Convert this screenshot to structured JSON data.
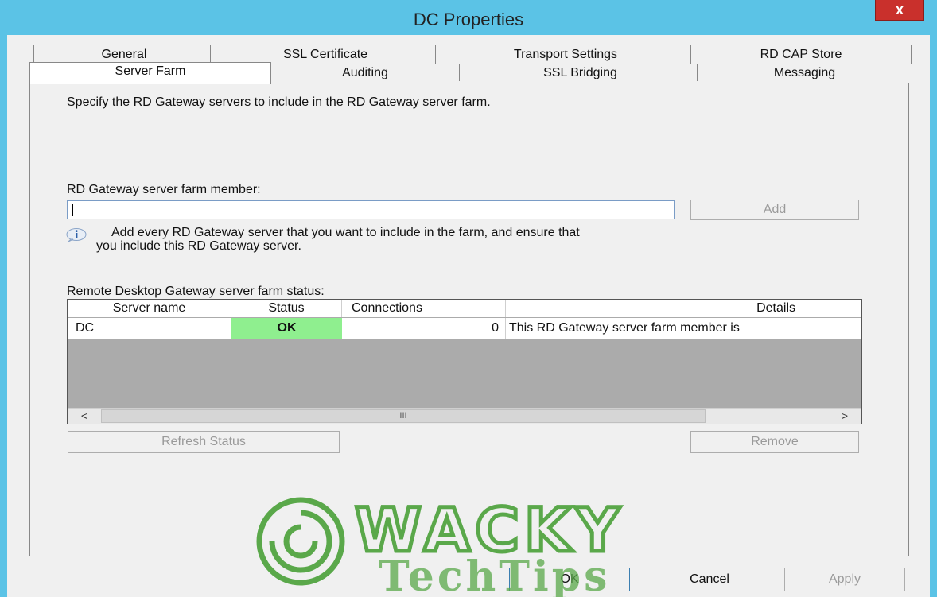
{
  "window": {
    "title": "DC Properties",
    "close_label": "x"
  },
  "tabs": {
    "row1": [
      "General",
      "SSL Certificate",
      "Transport Settings",
      "RD CAP Store"
    ],
    "row2": [
      "Server Farm",
      "Auditing",
      "SSL Bridging",
      "Messaging"
    ],
    "selected": "Server Farm"
  },
  "server_farm": {
    "description": "Specify the RD Gateway servers to include in the RD Gateway server farm.",
    "member_label": "RD Gateway server farm member:",
    "member_value": "",
    "add_label": "Add",
    "info_line1": "Add every RD Gateway server that you want to include in the farm, and ensure that",
    "info_line2": "you include this RD Gateway server.",
    "status_label": "Remote Desktop Gateway server farm status:",
    "columns": [
      "Server name",
      "Status",
      "Connections",
      "Details"
    ],
    "rows": [
      {
        "server": "DC",
        "status": "OK",
        "connections": "0",
        "details": "This RD Gateway server farm member is",
        "status_color": "#8fef8f"
      }
    ],
    "scroll_left": "<",
    "scroll_right": ">",
    "scroll_thumb": "III",
    "refresh_label": "Refresh Status",
    "remove_label": "Remove"
  },
  "footer": {
    "ok_label": "OK",
    "cancel_label": "Cancel",
    "apply_label": "Apply"
  },
  "watermark": {
    "line1": "WACKY",
    "line2": "TechTips"
  },
  "colors": {
    "title_bar": "#5bc3e6",
    "close": "#c9302c",
    "ok_status": "#8fef8f",
    "watermark": "#5aa84a"
  }
}
